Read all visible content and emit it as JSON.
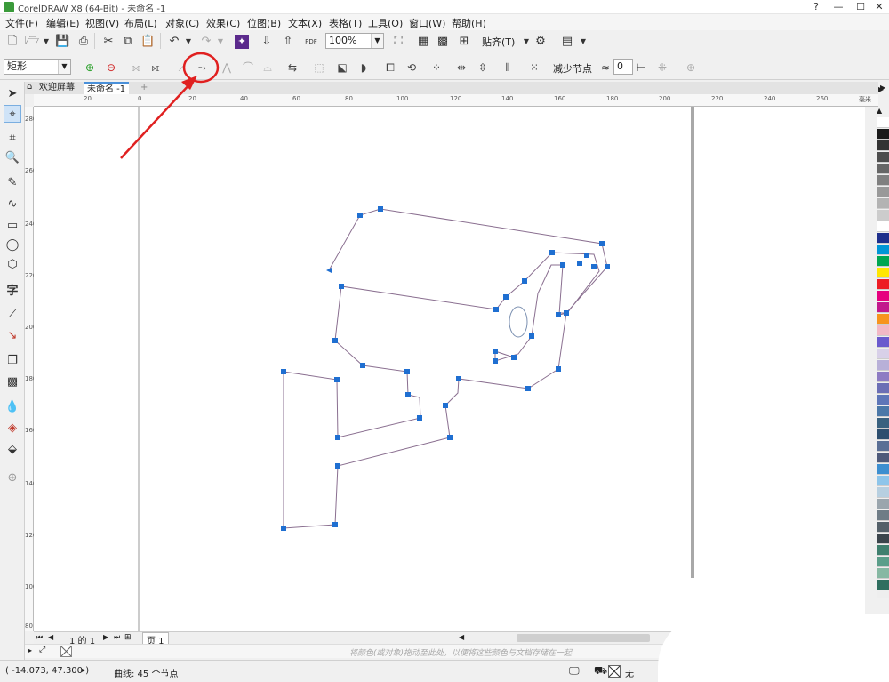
{
  "window": {
    "title": "CorelDRAW X8 (64-Bit) - 未命名 -1",
    "min": "—",
    "max": "☐",
    "close": "✕",
    "help": "?"
  },
  "menu": [
    "文件(F)",
    "编辑(E)",
    "视图(V)",
    "布局(L)",
    "对象(C)",
    "效果(C)",
    "位图(B)",
    "文本(X)",
    "表格(T)",
    "工具(O)",
    "窗口(W)",
    "帮助(H)"
  ],
  "toolbar1": {
    "zoom": "100%",
    "snap": "贴齐(T)",
    "pdf": "PDF"
  },
  "toolbar2": {
    "shape": "矩形",
    "reduce_nodes": "减少节点",
    "smoothness": "0"
  },
  "tabs": {
    "welcome": "欢迎屏幕",
    "document": "未命名 -1",
    "add": "+"
  },
  "ruler": {
    "top": [
      "20",
      "0",
      "20",
      "40",
      "60",
      "80",
      "100",
      "120",
      "140",
      "160",
      "180",
      "200",
      "220",
      "240",
      "260"
    ],
    "unit": "毫米",
    "left": [
      "280",
      "260",
      "240",
      "220",
      "200",
      "180",
      "160",
      "140",
      "120",
      "100",
      "80"
    ]
  },
  "pagebar": {
    "page_count": "1 的 1",
    "page_tab": "页 1"
  },
  "hint": "将颜色(或对象)拖动至此处，以便将这些颜色与文档存储在一起",
  "status": {
    "coords": "( -14.073, 47.300 )",
    "info": "曲线: 45 个节点",
    "fill": "无"
  },
  "annotation": {
    "color": "#e02020"
  },
  "palette": [
    "#ffffff",
    "#1a1a1a",
    "#333333",
    "#4d4d4d",
    "#666666",
    "#808080",
    "#999999",
    "#b3b3b3",
    "#cccccc",
    "#ffffff",
    "#1e2f8c",
    "#0096d6",
    "#00a651",
    "#ffe600",
    "#ed1c24",
    "#e6007e",
    "#c2188c",
    "#f7941d",
    "#f2b8c6",
    "#6a5acd",
    "#d8d0e8",
    "#b8b0d8",
    "#8e7cc3",
    "#6c6fb5",
    "#5e76b8",
    "#4b78a8",
    "#39617f",
    "#2d4e6e",
    "#5a6f95",
    "#4e5a7a",
    "#3d8fd0",
    "#8ec5ea",
    "#b7cfe0",
    "#9aa5ad",
    "#6f7c86",
    "#546069",
    "#3b454c",
    "#3f7f6e",
    "#5b9e8a",
    "#86b8a3",
    "#2f6e5f"
  ]
}
